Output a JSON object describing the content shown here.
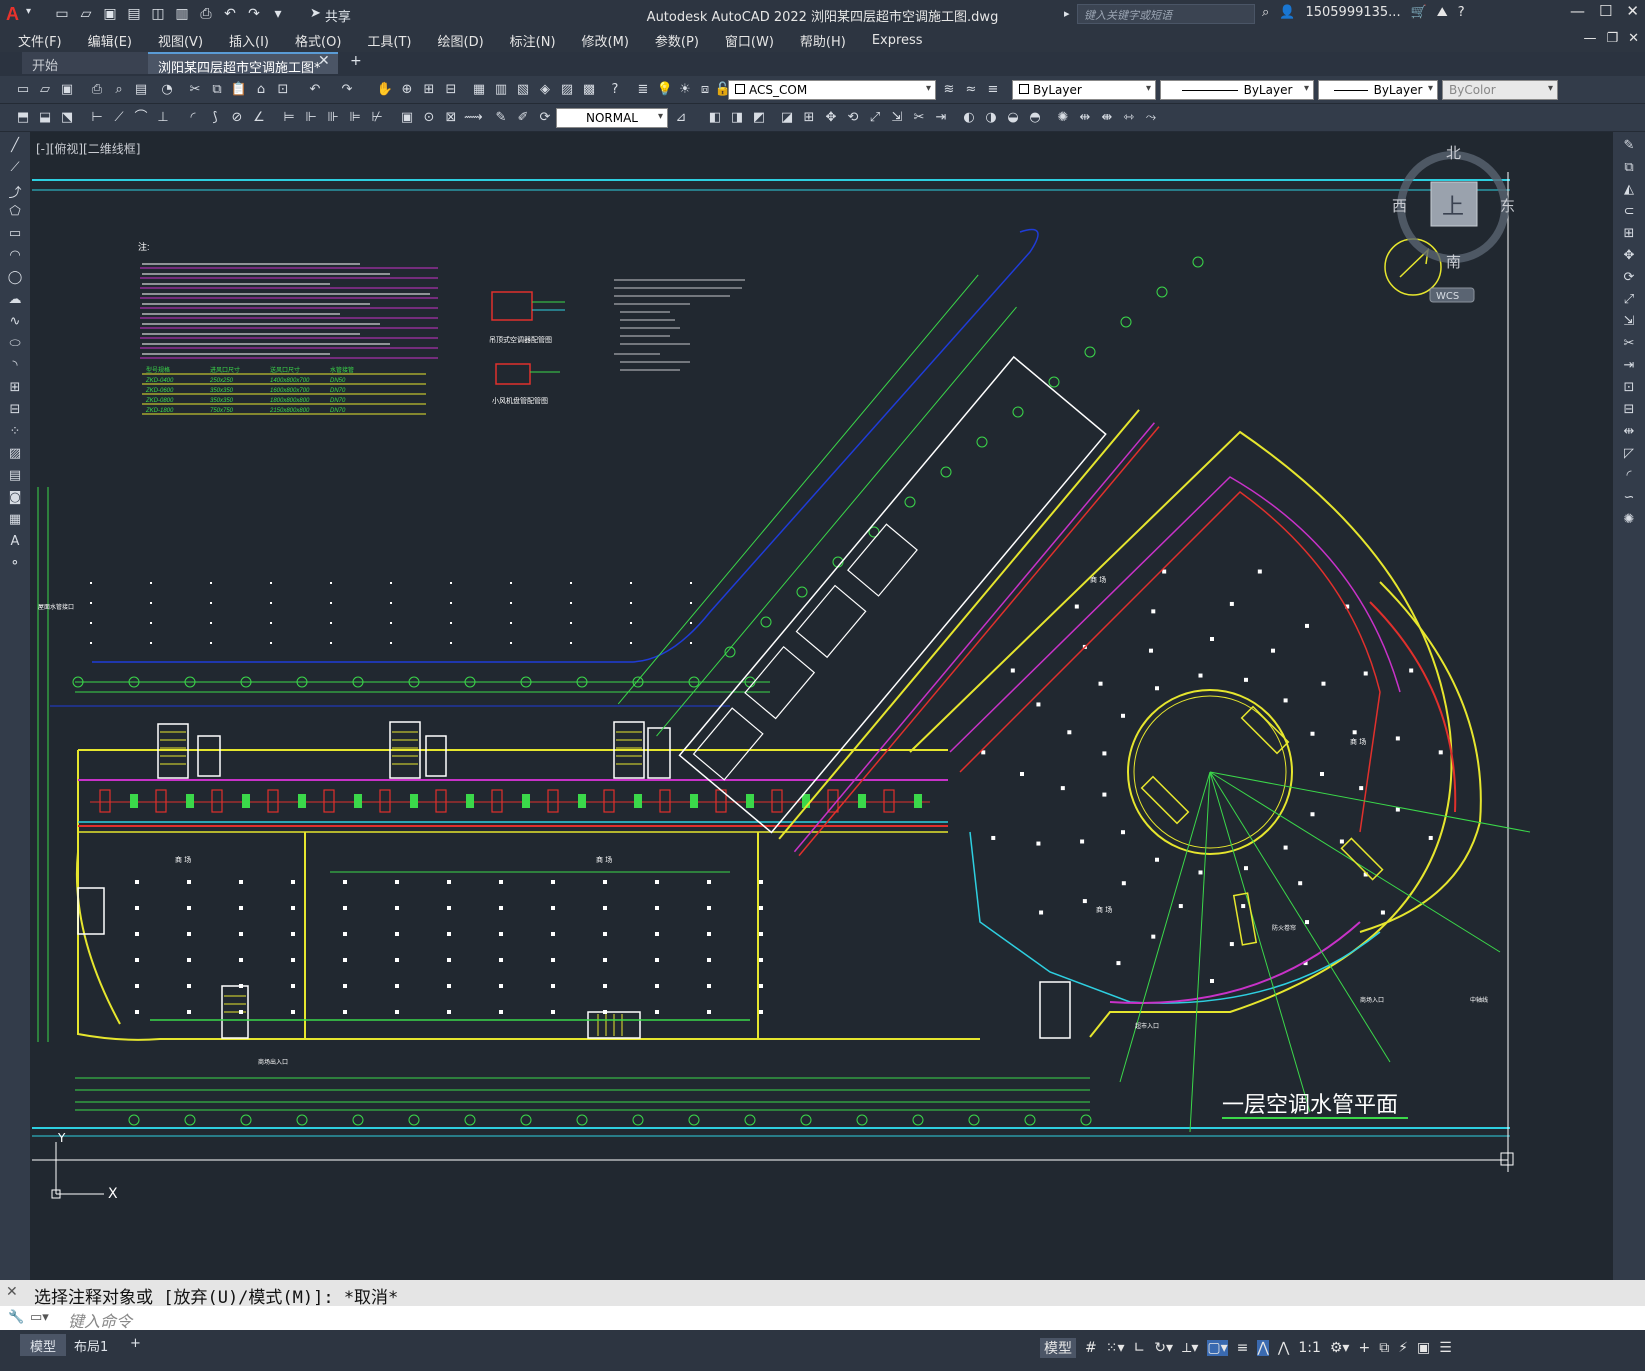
{
  "app": {
    "logo": "A",
    "window_title": "Autodesk AutoCAD 2022    浏阳某四层超市空调施工图.dwg",
    "share": "共享",
    "search_placeholder": "键入关键字或短语",
    "user": "1505999135...",
    "qat_icons": [
      "new-icon",
      "open-icon",
      "save-icon",
      "saveas-icon",
      "plot-icon",
      "undo-icon",
      "redo-icon"
    ]
  },
  "menu": [
    "文件(F)",
    "编辑(E)",
    "视图(V)",
    "插入(I)",
    "格式(O)",
    "工具(T)",
    "绘图(D)",
    "标注(N)",
    "修改(M)",
    "参数(P)",
    "窗口(W)",
    "帮助(H)",
    "Express"
  ],
  "tabs": {
    "start": "开始",
    "drawing": "浏阳某四层超市空调施工图*"
  },
  "toolbar": {
    "layer": "ACS_COM",
    "color": "ByLayer",
    "linetype": "ByLayer",
    "lineweight": "ByLayer",
    "plotstyle": "ByColor",
    "dimstyle": "NORMAL"
  },
  "canvas": {
    "view_label": "[-][俯视][二维线框]",
    "viewcube": {
      "north": "北",
      "south": "南",
      "east": "东",
      "west": "西",
      "top": "上",
      "wcs": "WCS"
    },
    "drawing_title": "一层空调水管平面",
    "ucs": {
      "x": "X",
      "y": "Y"
    },
    "notes_title": "注:",
    "zone_label": "商 场",
    "legend_labels": [
      "吊顶式空调器配管图",
      "小风机盘管配管图"
    ],
    "equipment_table": {
      "headers": [
        "型号规格",
        "进风口尺寸",
        "送风口尺寸",
        "水管接管"
      ],
      "rows": [
        [
          "ZKD-0400",
          "250x250",
          "1400x800x700",
          "DN50"
        ],
        [
          "ZKD-0600",
          "350x350",
          "1600x800x700",
          "DN70"
        ],
        [
          "ZKD-0800",
          "350x350",
          "1800x800x800",
          "DN70"
        ],
        [
          "ZKD-1800",
          "750x750",
          "2150x800x800",
          "DN70"
        ]
      ]
    },
    "annotations": [
      "屋面水管接口",
      "商场出入口",
      "防火卷帘",
      "中轴线",
      "商场入口",
      "超市入口"
    ]
  },
  "command": {
    "history": "选择注释对象或 [放弃(U)/模式(M)]: *取消*",
    "placeholder": "键入命令"
  },
  "status": {
    "layout_tabs": [
      "模型",
      "布局1"
    ],
    "model": "模型",
    "scale": "1:1"
  },
  "colors": {
    "canvas_bg": "#212830",
    "wall": "#e6e62e",
    "pipe_red": "#e0302c",
    "pipe_magenta": "#c832c8",
    "pipe_cyan": "#2ecfe0",
    "grid_green": "#3bd84a",
    "outline_white": "#ffffff",
    "dim_green": "#35e04a",
    "title_white": "#ffffff"
  }
}
